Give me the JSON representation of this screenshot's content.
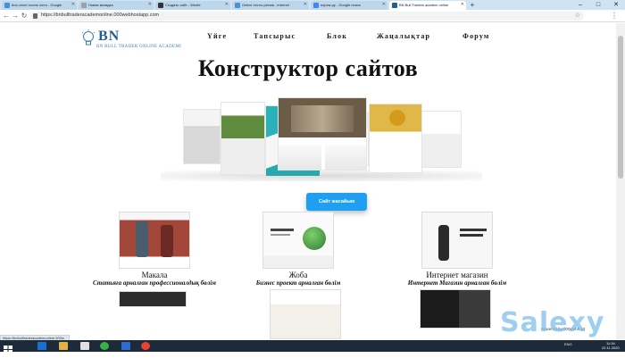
{
  "browser": {
    "tabs": [
      {
        "label": "bns omori rooms omm - Google",
        "color": "#4a90d9"
      },
      {
        "label": "Новая вкладка",
        "color": "#9aa0a6"
      },
      {
        "label": "Создать сайт - Weebl",
        "color": "#333333"
      },
      {
        "label": "Online тесты ресми - internet",
        "color": "#4a90d9"
      },
      {
        "label": "пореж.ру - Google поиск",
        "color": "#4285f4"
      },
      {
        "label": "BN Bull Traders academ online",
        "color": "#1f5f93"
      }
    ],
    "active_tab_index": 5,
    "url": "https://bnbulltraderacademonline.000webhostapp.com"
  },
  "site": {
    "logo_mark": "BN",
    "logo_text": "BN BULL TRADER ONLINE ACADEMI",
    "nav": [
      "Үйге",
      "Тапсырыс",
      "Блок",
      "Жаңалықтар",
      "Форум"
    ],
    "headline": "Конструктор сайтов",
    "cta_label": "Сайт жасайым",
    "cards": [
      {
        "title": "Макала",
        "subtitle": "Статьяға арналған профессионалдық бөлім"
      },
      {
        "title": "Жоба",
        "subtitle": "Бизнес проект арналған бөлім"
      },
      {
        "title": "Интернет магазин",
        "subtitle": "Интернет Магазин арналған бөлім"
      }
    ],
    "hosted_by": "Powered by 000webhost",
    "watermark": "Salexy"
  },
  "status_url": "https://bnbulltraderacademonline.000w",
  "taskbar": {
    "lang": "ENG",
    "time": "11:34",
    "date": "22.11.2020"
  },
  "colors": {
    "accent": "#1e9ff2",
    "logo": "#1f5f93",
    "taskbar": "#1c2a3a"
  }
}
